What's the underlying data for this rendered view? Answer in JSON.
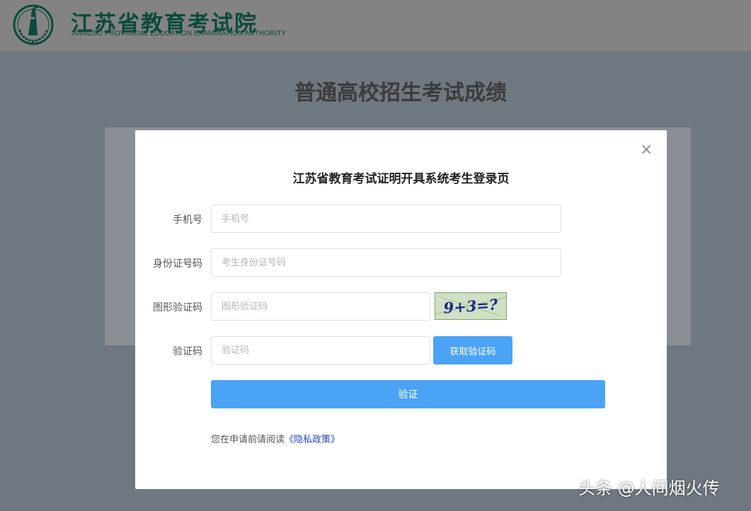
{
  "header": {
    "org_name_cn": "江苏省教育考试院",
    "org_name_en": "JIANGSU PROVINCIAL EDUCATION EXAMINATION AUTHORITY",
    "emblem_icon": "exam-authority-emblem-icon"
  },
  "page": {
    "title": "普通高校招生考试成绩"
  },
  "modal": {
    "title": "江苏省教育考试证明开具系统考生登录页",
    "close_icon": "close-icon",
    "close_glyph": "×",
    "fields": {
      "phone": {
        "label": "手机号",
        "value": "",
        "placeholder": "手机号"
      },
      "id_number": {
        "label": "身份证号码",
        "value": "",
        "placeholder": "考生身份证号码"
      },
      "captcha": {
        "label": "图形验证码",
        "value": "",
        "placeholder": "图形验证码",
        "image_text": "9+3=?"
      },
      "sms_code": {
        "label": "验证码",
        "value": "",
        "placeholder": "验证码"
      }
    },
    "get_code_button": "获取验证码",
    "verify_button": "验证",
    "privacy": {
      "prefix": "您在申请前请阅读",
      "link": "《隐私政策》"
    }
  },
  "watermark": "头条 @人间烟火传",
  "colors": {
    "primary_button": "#4aa3f5",
    "brand_green": "#0b4a3d",
    "link": "#1f47c8",
    "overlay": "#6f7780"
  }
}
